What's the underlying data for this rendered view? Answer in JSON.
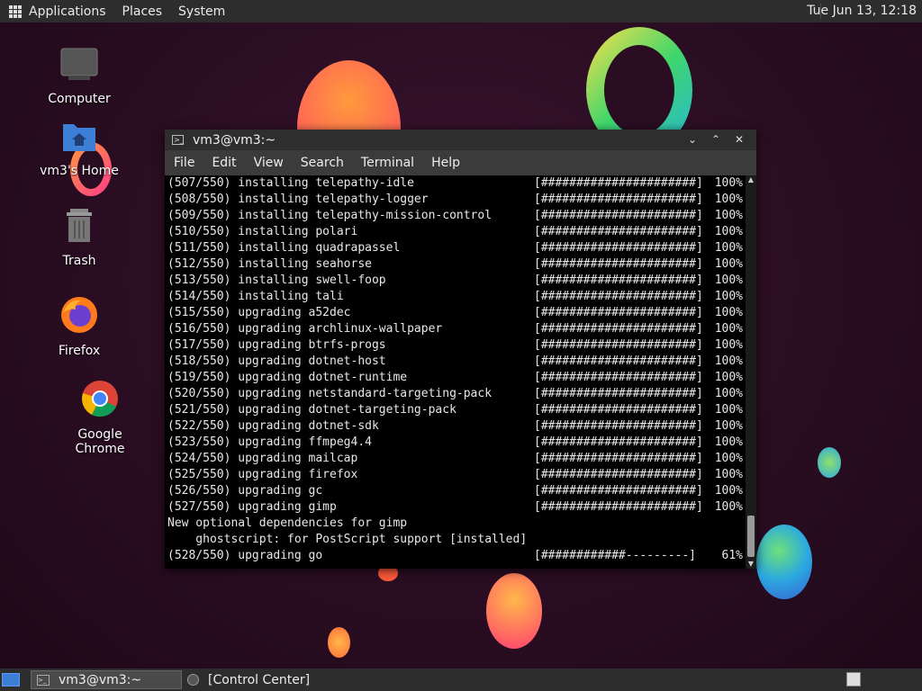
{
  "top_panel": {
    "menus": [
      "Applications",
      "Places",
      "System"
    ],
    "clock": "Tue Jun 13, 12:18"
  },
  "desktop_icons": [
    {
      "label": "Computer",
      "icon": "computer-icon"
    },
    {
      "label": "vm3's Home",
      "icon": "home-folder-icon"
    },
    {
      "label": "Trash",
      "icon": "trash-icon"
    },
    {
      "label": "Firefox",
      "icon": "firefox-icon"
    },
    {
      "label": "Google Chrome",
      "icon": "chrome-icon"
    }
  ],
  "terminal": {
    "title": "vm3@vm3:~",
    "menu": [
      "File",
      "Edit",
      "View",
      "Search",
      "Terminal",
      "Help"
    ],
    "lines": [
      {
        "text": "(507/550) installing telepathy-idle",
        "bar": "[######################]",
        "pct": "100%"
      },
      {
        "text": "(508/550) installing telepathy-logger",
        "bar": "[######################]",
        "pct": "100%"
      },
      {
        "text": "(509/550) installing telepathy-mission-control",
        "bar": "[######################]",
        "pct": "100%"
      },
      {
        "text": "(510/550) installing polari",
        "bar": "[######################]",
        "pct": "100%"
      },
      {
        "text": "(511/550) installing quadrapassel",
        "bar": "[######################]",
        "pct": "100%"
      },
      {
        "text": "(512/550) installing seahorse",
        "bar": "[######################]",
        "pct": "100%"
      },
      {
        "text": "(513/550) installing swell-foop",
        "bar": "[######################]",
        "pct": "100%"
      },
      {
        "text": "(514/550) installing tali",
        "bar": "[######################]",
        "pct": "100%"
      },
      {
        "text": "(515/550) upgrading a52dec",
        "bar": "[######################]",
        "pct": "100%"
      },
      {
        "text": "(516/550) upgrading archlinux-wallpaper",
        "bar": "[######################]",
        "pct": "100%"
      },
      {
        "text": "(517/550) upgrading btrfs-progs",
        "bar": "[######################]",
        "pct": "100%"
      },
      {
        "text": "(518/550) upgrading dotnet-host",
        "bar": "[######################]",
        "pct": "100%"
      },
      {
        "text": "(519/550) upgrading dotnet-runtime",
        "bar": "[######################]",
        "pct": "100%"
      },
      {
        "text": "(520/550) upgrading netstandard-targeting-pack",
        "bar": "[######################]",
        "pct": "100%"
      },
      {
        "text": "(521/550) upgrading dotnet-targeting-pack",
        "bar": "[######################]",
        "pct": "100%"
      },
      {
        "text": "(522/550) upgrading dotnet-sdk",
        "bar": "[######################]",
        "pct": "100%"
      },
      {
        "text": "(523/550) upgrading ffmpeg4.4",
        "bar": "[######################]",
        "pct": "100%"
      },
      {
        "text": "(524/550) upgrading mailcap",
        "bar": "[######################]",
        "pct": "100%"
      },
      {
        "text": "(525/550) upgrading firefox",
        "bar": "[######################]",
        "pct": "100%"
      },
      {
        "text": "(526/550) upgrading gc",
        "bar": "[######################]",
        "pct": "100%"
      },
      {
        "text": "(527/550) upgrading gimp",
        "bar": "[######################]",
        "pct": "100%"
      },
      {
        "text": "New optional dependencies for gimp",
        "bar": "",
        "pct": ""
      },
      {
        "text": "    ghostscript: for PostScript support [installed]",
        "bar": "",
        "pct": ""
      },
      {
        "text": "(528/550) upgrading go",
        "bar": "[############---------]",
        "pct": " 61%"
      }
    ]
  },
  "taskbar": {
    "tasks": [
      {
        "label": "vm3@vm3:~",
        "active": true
      },
      {
        "label": "[Control Center]",
        "active": false
      }
    ]
  },
  "colors": {
    "panel": "#2d2d2d",
    "terminal_bg": "#000000",
    "terminal_fg": "#e8e8e8",
    "accent": "#3d7fd6"
  }
}
